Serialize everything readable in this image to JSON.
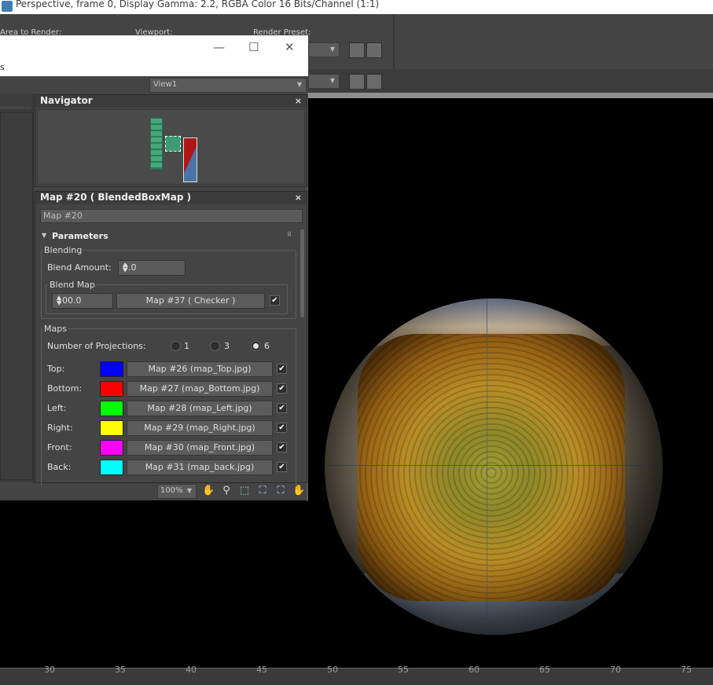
{
  "titlebar": {
    "text": "Perspective, frame 0, Display Gamma: 2.2, RGBA Color 16 Bits/Channel (1:1)"
  },
  "toolbar": {
    "area_to_render_label": "Area to Render:",
    "viewport_label": "Viewport:",
    "render_preset_label": "Render Preset:"
  },
  "window": {
    "partial_menu_text": "s",
    "minimize": "—",
    "maximize": "☐",
    "close": "✕",
    "view_dropdown": "View1"
  },
  "navigator": {
    "title": "Navigator",
    "close": "×"
  },
  "map_editor": {
    "title": "Map #20  ( BlendedBoxMap )",
    "close": "×",
    "map_name": "Map #20",
    "parameters_label": "Parameters",
    "blending": {
      "group_label": "Blending",
      "blend_amount_label": "Blend Amount:",
      "blend_amount_value": "0.0",
      "blend_map_label": "Blend Map",
      "blend_map_amount": "100.0",
      "blend_map_button": "Map #37  ( Checker )",
      "blend_map_checked": "✔"
    },
    "maps": {
      "group_label": "Maps",
      "num_projections_label": "Number of Projections:",
      "projection_options": [
        "1",
        "3",
        "6"
      ],
      "selected_projection": "6",
      "rows": [
        {
          "label": "Top:",
          "color": "#0000ff",
          "map": "Map #26 (map_Top.jpg)",
          "checked": "✔"
        },
        {
          "label": "Bottom:",
          "color": "#ff0000",
          "map": "Map #27 (map_Bottom.jpg)",
          "checked": "✔"
        },
        {
          "label": "Left:",
          "color": "#00ff00",
          "map": "Map #28 (map_Left.jpg)",
          "checked": "✔"
        },
        {
          "label": "Right:",
          "color": "#ffff00",
          "map": "Map #29 (map_Right.jpg)",
          "checked": "✔"
        },
        {
          "label": "Front:",
          "color": "#ff00ff",
          "map": "Map #30 (map_Front.jpg)",
          "checked": "✔"
        },
        {
          "label": "Back:",
          "color": "#00ffff",
          "map": "Map #31 (map_back.jpg)",
          "checked": "✔"
        }
      ]
    }
  },
  "status": {
    "zoom": "100%",
    "icons": [
      "pan-hand-icon",
      "zoom-magnifier-icon",
      "zoom-region-icon",
      "zoom-extents-icon",
      "zoom-selected-icon",
      "pan-view-icon"
    ]
  },
  "ruler": {
    "ticks": [
      "30",
      "35",
      "40",
      "45",
      "50",
      "55",
      "60",
      "65",
      "70",
      "75"
    ]
  }
}
